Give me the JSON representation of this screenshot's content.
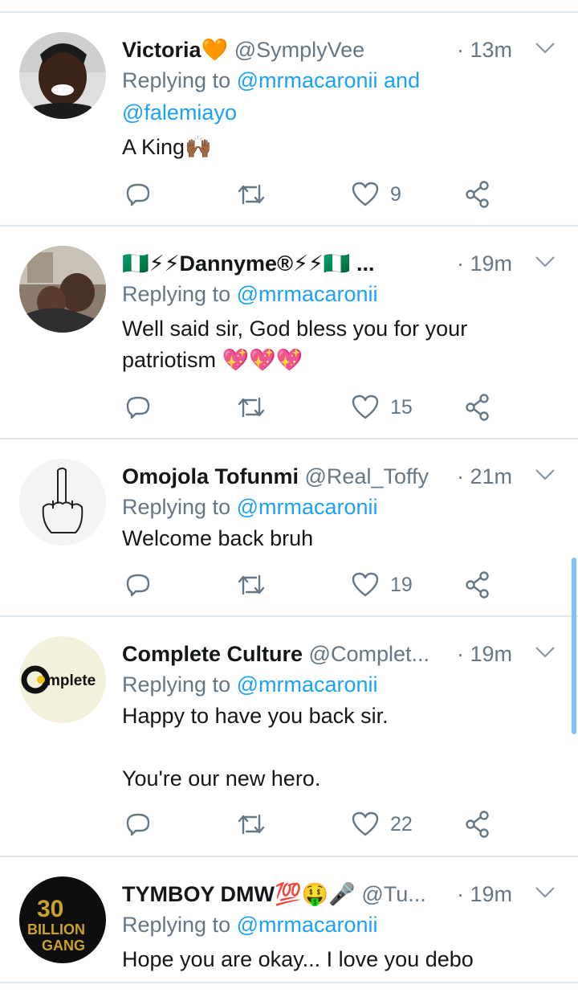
{
  "tweets": [
    {
      "name": "Victoria🧡",
      "handle": "@SymplyVee",
      "time": "· 13m",
      "reply_prefix": "Replying to ",
      "reply_to": "@mrmacaronii",
      "reply_and": " and",
      "reply_to_2": "@falemiayo",
      "body": [
        "A King🙌🏾"
      ],
      "likes": "9"
    },
    {
      "name": "🇳🇬⚡⚡Dannyme®⚡⚡🇳🇬 ...",
      "handle": "",
      "time": "· 19m",
      "reply_prefix": "Replying to ",
      "reply_to": "@mrmacaronii",
      "body": [
        "Well said sir, God bless you for your patriotism 💖💖💖"
      ],
      "likes": "15"
    },
    {
      "name": "Omojola Tofunmi",
      "handle": "@Real_Toffy",
      "time": "· 21m",
      "reply_prefix": "Replying to ",
      "reply_to": "@mrmacaronii",
      "body": [
        "Welcome back bruh"
      ],
      "likes": "19"
    },
    {
      "name": "Complete Culture",
      "handle": "@Complet...",
      "time": "· 19m",
      "reply_prefix": "Replying to ",
      "reply_to": "@mrmacaronii",
      "body": [
        "Happy to have you back sir.",
        "",
        "You're our new hero."
      ],
      "likes": "22",
      "avatar_text": "mplete"
    },
    {
      "name": "TYMBOY DMW💯🤑🎤",
      "handle": "@Tu...",
      "time": "· 19m",
      "reply_prefix": "Replying to ",
      "reply_to": "@mrmacaronii",
      "body": [
        "Hope you are okay... I love you debo"
      ],
      "avatar_text": "30 BILLION GANG"
    }
  ],
  "icons": {
    "reply": "reply-icon",
    "retweet": "retweet-icon",
    "like": "like-icon",
    "share": "share-icon",
    "more": "chevron-down-icon"
  },
  "colors": {
    "link": "#1da1f2",
    "muted": "#657786",
    "text": "#14171a",
    "divider": "#e1e8ed"
  }
}
